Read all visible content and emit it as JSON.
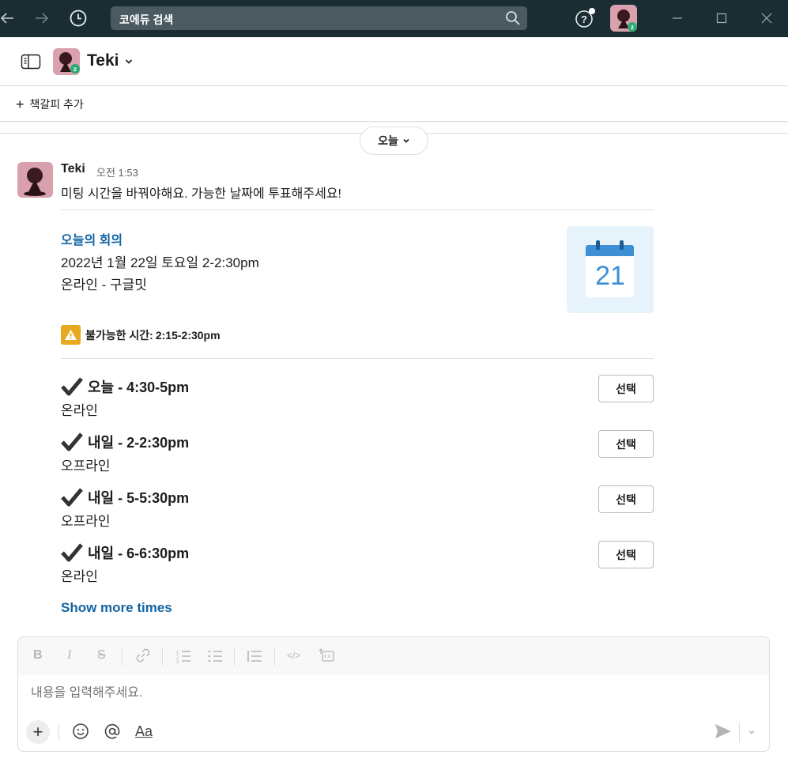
{
  "titlebar": {
    "search_placeholder": "코에듀 검색",
    "icons": [
      "back-arrow-icon",
      "forward-arrow-icon",
      "history-icon",
      "search-icon",
      "help-icon",
      "minimize-icon",
      "maximize-icon",
      "close-icon"
    ]
  },
  "channel": {
    "name": "Teki",
    "bookmark_add": "책갈피 추가",
    "date_divider": "오늘"
  },
  "message": {
    "author": "Teki",
    "time": "오전 1:53",
    "text": "미팅 시간을 바꿔야해요. 가능한 날짜에 투표해주세요!",
    "event": {
      "title": "오늘의 회의",
      "date": "2022년 1월 22일 토요일 2-2:30pm",
      "location": "온라인 - 구글밋",
      "calendar_day": "21"
    },
    "warning": {
      "label": "불가능한 시간:",
      "value": "2:15-2:30pm"
    },
    "options": [
      {
        "title": "오늘 - 4:30-5pm",
        "subtitle": "온라인",
        "button": "선택"
      },
      {
        "title": "내일 - 2-2:30pm",
        "subtitle": "오프라인",
        "button": "선택"
      },
      {
        "title": "내일 - 5-5:30pm",
        "subtitle": "오프라인",
        "button": "선택"
      },
      {
        "title": "내일 - 6-6:30pm",
        "subtitle": "온라인",
        "button": "선택"
      }
    ],
    "show_more": "Show more times"
  },
  "composer": {
    "placeholder": "내용을 입력해주세요.",
    "format_bold": "B",
    "format_italic": "I",
    "format_strike": "S",
    "format_code": "</>",
    "aa": "Aa"
  },
  "colors": {
    "titlebar_bg": "#1a2d33",
    "link": "#1264a3",
    "warning": "#e8a820",
    "calendar_blue": "#3d8fd6"
  }
}
